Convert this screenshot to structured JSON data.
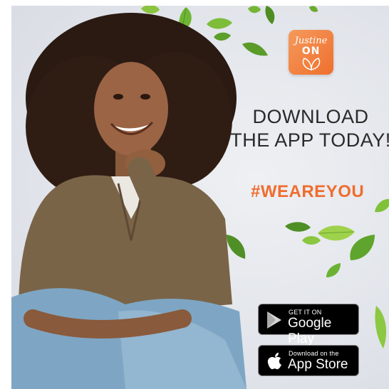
{
  "logo": {
    "script": "Justine",
    "word": "ON"
  },
  "headline": {
    "line1": "DOWNLOAD",
    "line2": "THE APP TODAY!"
  },
  "hashtag": "#WEAREYOU",
  "google_play": {
    "small": "GET IT ON",
    "big": "Google Play"
  },
  "app_store": {
    "small": "Download on the",
    "big": "App Store"
  },
  "colors": {
    "accent": "#ef6d2f",
    "leaf": "#7fc23a",
    "badge": "#000000"
  },
  "icons": [
    "leaf-icon",
    "google-play-icon",
    "apple-icon"
  ]
}
